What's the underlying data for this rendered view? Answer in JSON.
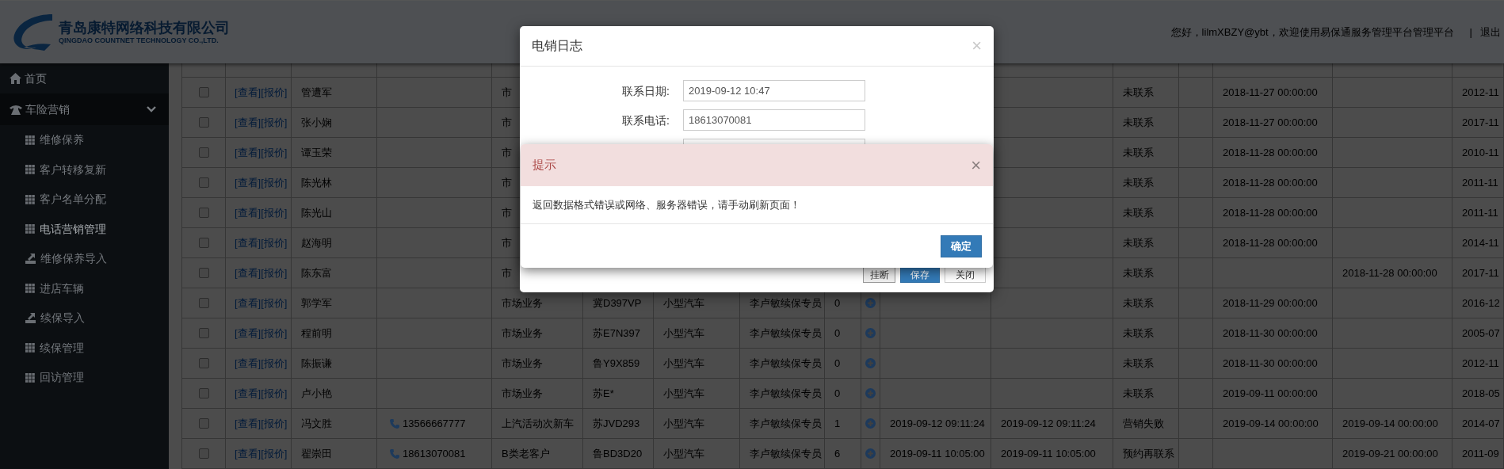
{
  "header": {
    "company": "青岛康特网络科技有限公司",
    "company_en": "QINGDAO COUNTNET TECHNOLOGY CO.,LTD.",
    "greeting": "您好，lilmXBZY@ybt，欢迎使用易保通服务管理平台管理平台",
    "separator": "|",
    "logout": "退出"
  },
  "sidebar": {
    "items": [
      {
        "label": "首页",
        "kind": "home"
      },
      {
        "label": "车险营销",
        "kind": "phone",
        "expanded": true,
        "children": [
          {
            "label": "维修保养",
            "kind": "grid",
            "selected": false
          },
          {
            "label": "客户转移复新",
            "kind": "grid",
            "selected": false
          },
          {
            "label": "客户名单分配",
            "kind": "grid",
            "selected": false
          },
          {
            "label": "电话营销管理",
            "kind": "grid",
            "selected": true
          },
          {
            "label": "维修保养导入",
            "kind": "upload",
            "selected": false
          },
          {
            "label": "进店车辆",
            "kind": "grid",
            "selected": false
          },
          {
            "label": "续保导入",
            "kind": "upload",
            "selected": false
          },
          {
            "label": "续保管理",
            "kind": "grid",
            "selected": false
          },
          {
            "label": "回访管理",
            "kind": "grid",
            "selected": false
          }
        ]
      }
    ]
  },
  "table": {
    "rows": [
      {
        "checked": false,
        "actions": [
          "[查看]",
          "[报价]"
        ],
        "name": "管遭军",
        "source": "市",
        "status": "未联系",
        "date_1": "2018-11-27 00:00:00",
        "date_3": "2012-11"
      },
      {
        "checked": false,
        "actions": [
          "[查看]",
          "[报价]"
        ],
        "name": "张小娴",
        "source": "市",
        "status": "未联系",
        "date_1": "2018-11-27 00:00:00",
        "date_3": "2017-11"
      },
      {
        "checked": false,
        "actions": [
          "[查看]",
          "[报价]"
        ],
        "name": "谭玉荣",
        "source": "市",
        "status": "未联系",
        "date_1": "2018-11-28 00:00:00",
        "date_3": "2010-11"
      },
      {
        "checked": false,
        "actions": [
          "[查看]",
          "[报价]"
        ],
        "name": "陈光林",
        "source": "市",
        "status": "未联系",
        "date_1": "2018-11-28 00:00:00",
        "date_3": "2011-11"
      },
      {
        "checked": false,
        "actions": [
          "[查看]",
          "[报价]"
        ],
        "name": "陈光山",
        "source": "市",
        "status": "未联系",
        "date_1": "2018-11-28 00:00:00",
        "date_3": "2011-11"
      },
      {
        "checked": false,
        "actions": [
          "[查看]",
          "[报价]"
        ],
        "name": "赵海明",
        "source": "市",
        "status": "未联系",
        "date_1": "2018-11-28 00:00:00",
        "date_3": "2014-11"
      },
      {
        "checked": false,
        "actions": [
          "[查看]",
          "[报价]"
        ],
        "name": "陈东富",
        "source": "市",
        "status": "未联系",
        "date_2": "2018-11-28 00:00:00",
        "date_3": "2017-11"
      },
      {
        "checked": false,
        "actions": [
          "[查看]",
          "[报价]"
        ],
        "name": "郭学军",
        "source": "市场业务",
        "plate": "冀D397VP",
        "vehicle": "小型汽车",
        "staff": "李卢敏续保专员",
        "count": "0",
        "status": "未联系",
        "date_1": "2018-11-29 00:00:00",
        "date_3": "2016-12"
      },
      {
        "checked": false,
        "actions": [
          "[查看]",
          "[报价]"
        ],
        "name": "程前明",
        "source": "市场业务",
        "plate": "苏E7N397",
        "vehicle": "小型汽车",
        "staff": "李卢敏续保专员",
        "count": "0",
        "status": "未联系",
        "date_1": "2018-11-30 00:00:00",
        "date_3": "2005-07"
      },
      {
        "checked": false,
        "actions": [
          "[查看]",
          "[报价]"
        ],
        "name": "陈振谦",
        "source": "市场业务",
        "plate": "鲁Y9X859",
        "vehicle": "小型汽车",
        "staff": "李卢敏续保专员",
        "count": "0",
        "status": "未联系",
        "date_1": "2018-11-30 00:00:00",
        "date_3": "2012-11"
      },
      {
        "checked": false,
        "actions": [
          "[查看]",
          "[报价]"
        ],
        "name": "卢小艳",
        "source": "市场业务",
        "plate": "苏E*",
        "vehicle": "小型汽车",
        "staff": "李卢敏续保专员",
        "count": "0",
        "status": "未联系",
        "date_1": "2019-09-11 00:00:00",
        "date_3": "2018-05"
      },
      {
        "checked": false,
        "actions": [
          "[查看]",
          "[报价]"
        ],
        "name": "冯文胜",
        "phone": "13566667777",
        "source": "上汽活动次新车",
        "plate": "苏JVD293",
        "vehicle": "小型汽车",
        "staff": "李卢敏续保专员",
        "count": "1",
        "time_1": "2019-09-12 09:11:24",
        "time_2": "2019-09-12 09:11:24",
        "status": "营销失败",
        "date_1": "2019-09-14 00:00:00",
        "date_2": "2019-09-14 00:00:00",
        "date_3": "2014-07"
      },
      {
        "checked": false,
        "actions": [
          "[查看]",
          "[报价]"
        ],
        "name": "翟崇田",
        "phone": "18613070081",
        "source": "B类老客户",
        "plate": "鲁BD3D20",
        "vehicle": "小型汽车",
        "staff": "李卢敏续保专员",
        "count": "6",
        "time_1": "2019-09-11 10:05:00",
        "time_2": "2019-09-11 10:05:00",
        "status": "预约再联系",
        "date_2": "2019-09-21 00:00:00",
        "date_3": "2011-09"
      }
    ]
  },
  "log_dialog": {
    "title": "电销日志",
    "close": "×",
    "fields": [
      {
        "kind": "input",
        "label": "联系日期:",
        "value": "2019-09-12 10:47"
      },
      {
        "kind": "input",
        "label": "联系电话:",
        "value": "18613070081"
      },
      {
        "kind": "input"
      }
    ],
    "buttons": [
      {
        "label": "挂断",
        "kind": "plain"
      },
      {
        "label": "保存",
        "kind": "primary"
      },
      {
        "label": "关闭",
        "kind": "default"
      }
    ]
  },
  "alert_dialog": {
    "title": "提示",
    "close": "×",
    "message": "返回数据格式错误或网络、服务器错误，请手动刷新页面！",
    "button": "确定"
  }
}
